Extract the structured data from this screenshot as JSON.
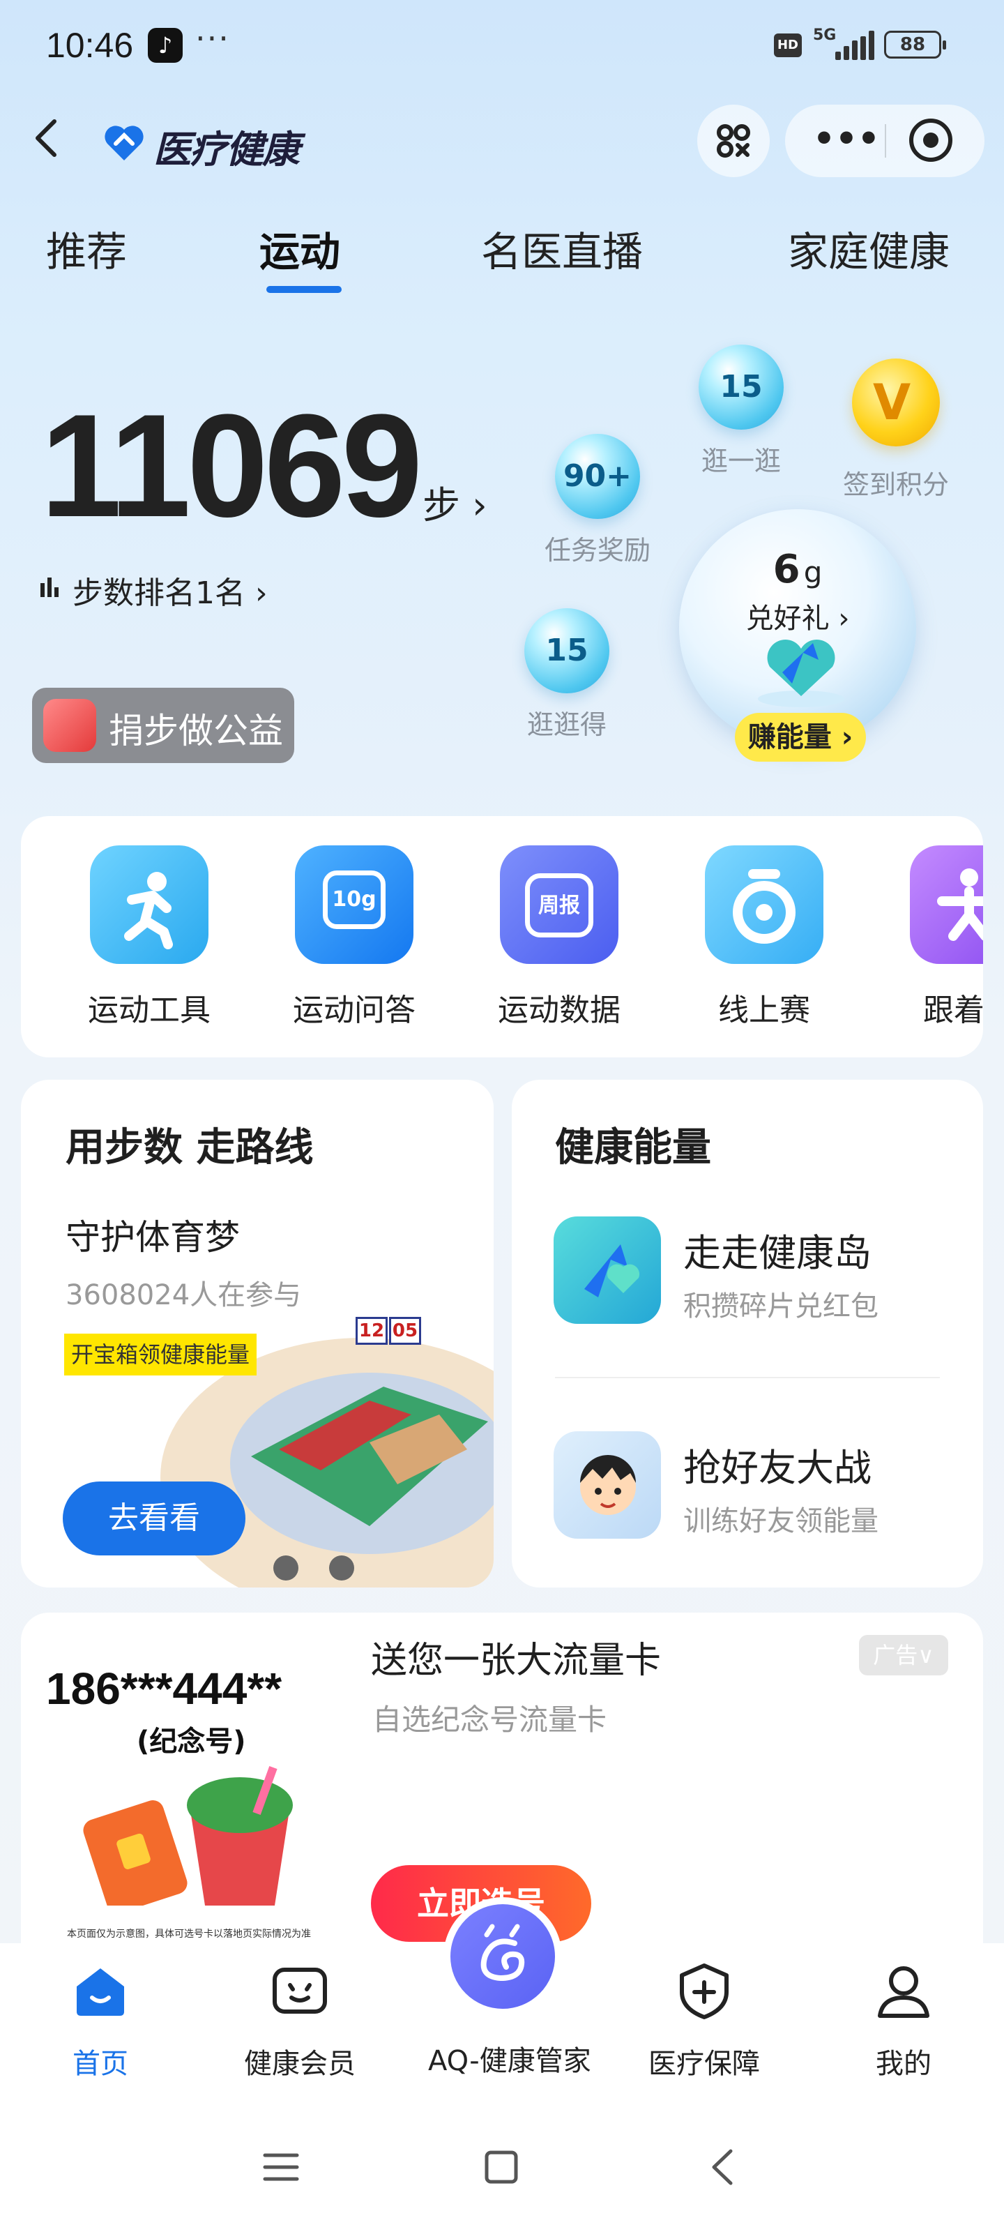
{
  "status_bar": {
    "time": "10:46",
    "dots": "···",
    "hd": "HD",
    "network": "5G",
    "battery": "88"
  },
  "header": {
    "app_name": "医疗健康"
  },
  "tabs": [
    {
      "label": "推荐",
      "active": false
    },
    {
      "label": "运动",
      "active": true
    },
    {
      "label": "名医直播",
      "active": false
    },
    {
      "label": "家庭健康",
      "active": false
    }
  ],
  "steps": {
    "count": "11069",
    "unit": "步",
    "rank": "步数排名1名",
    "donate": "捐步做公益"
  },
  "bubbles": [
    {
      "value": "15",
      "label": "逛一逛"
    },
    {
      "value": "90+",
      "label": "任务奖励"
    },
    {
      "value": "15",
      "label": "逛逛得"
    }
  ],
  "coin": {
    "label": "签到积分",
    "icon": "v-coin-icon"
  },
  "gift": {
    "grams": "6",
    "unit": "g",
    "label": "兑好礼",
    "earn": "赚能量"
  },
  "tools": [
    {
      "label": "运动工具",
      "icon": "running-person-icon",
      "color": "#37b8f2"
    },
    {
      "label": "运动问答",
      "icon": "10g-chat-icon",
      "badge": "10g",
      "color": "#1f8cf5"
    },
    {
      "label": "运动数据",
      "icon": "weekly-report-icon",
      "badge": "周报",
      "color": "#4f6df2"
    },
    {
      "label": "线上赛",
      "icon": "medal-icon",
      "color": "#3cb5f5"
    },
    {
      "label": "跟着练",
      "icon": "exercise-icon",
      "color": "#a35cf0"
    }
  ],
  "route_card": {
    "title": "用步数 走路线",
    "subtitle": "守护体育梦",
    "participants": "3608024人在参与",
    "tag": "开宝箱领健康能量",
    "button": "去看看",
    "scoreboard": [
      "12",
      "05"
    ]
  },
  "energy_card": {
    "title": "健康能量",
    "items": [
      {
        "title": "走走健康岛",
        "desc": "积攒碎片兑红包"
      },
      {
        "title": "抢好友大战",
        "desc": "训练好友领能量"
      }
    ]
  },
  "ad": {
    "number": "186***444**",
    "number_note": "(纪念号)",
    "title": "送您一张大流量卡",
    "subtitle": "自选纪念号流量卡",
    "badge": "广告",
    "disclaimer": "本页面仅为示意图，具体可选号卡以落地页实际情况为准",
    "button": "立即选号"
  },
  "bottom_nav": [
    {
      "label": "首页",
      "active": true
    },
    {
      "label": "健康会员",
      "active": false
    },
    {
      "label": "AQ-健康管家",
      "active": false
    },
    {
      "label": "医疗保障",
      "active": false
    },
    {
      "label": "我的",
      "active": false
    }
  ]
}
